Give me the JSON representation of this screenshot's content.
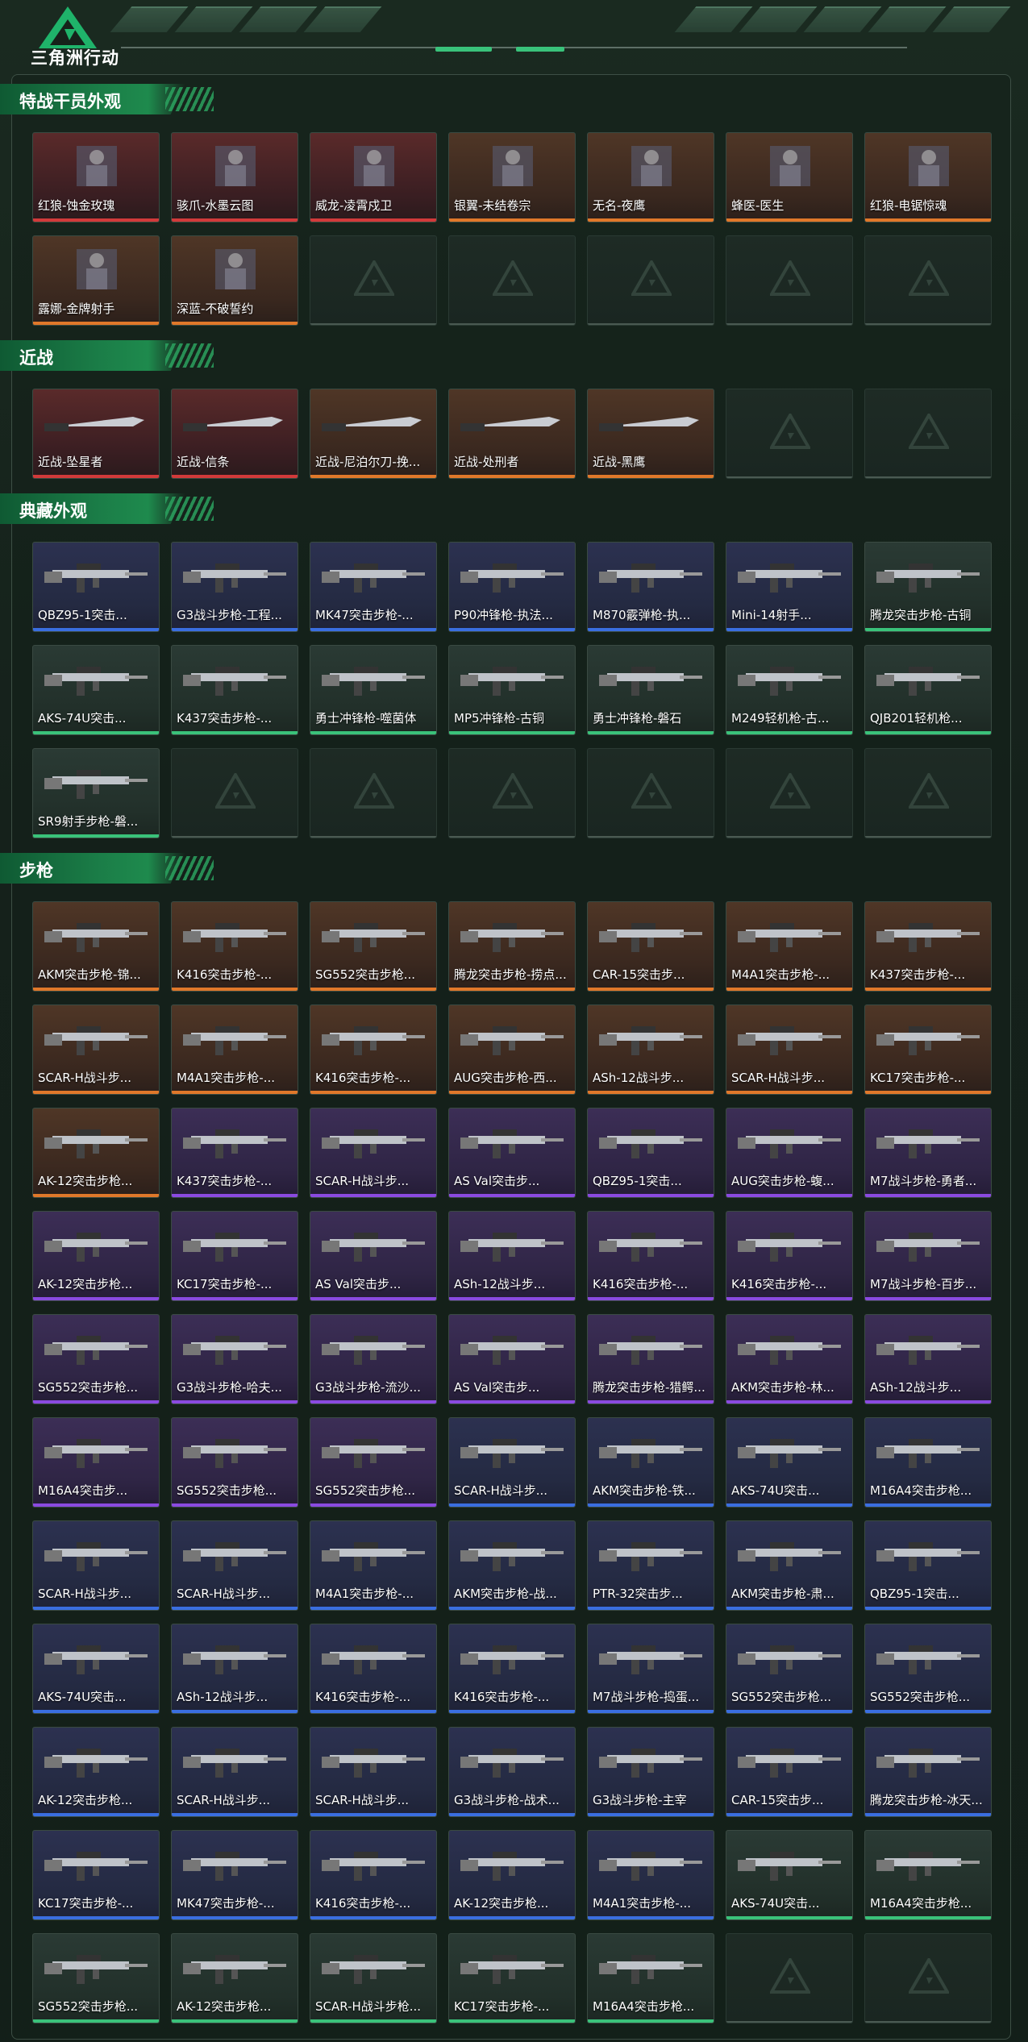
{
  "app": {
    "brand": "三角洲行动"
  },
  "colors": {
    "accent": "#39c27a",
    "panel_border": "#3d4f45",
    "red": "#d23a3a",
    "orange": "#e0782a",
    "blue": "#3a6ee0",
    "purple": "#8a4ae0",
    "green": "#3ac27a"
  },
  "sections": [
    {
      "title": "特战干员外观",
      "items": [
        {
          "label": "红狼-蚀金玫瑰",
          "rarity": "red",
          "icon": "operator-icon"
        },
        {
          "label": "骇爪-水墨云图",
          "rarity": "red",
          "icon": "operator-icon"
        },
        {
          "label": "威龙-凌霄戍卫",
          "rarity": "red",
          "icon": "operator-icon"
        },
        {
          "label": "银翼-未结卷宗",
          "rarity": "orange",
          "icon": "operator-icon"
        },
        {
          "label": "无名-夜鹰",
          "rarity": "orange",
          "icon": "operator-icon"
        },
        {
          "label": "蜂医-医生",
          "rarity": "orange",
          "icon": "operator-icon"
        },
        {
          "label": "红狼-电锯惊魂",
          "rarity": "orange",
          "icon": "operator-icon"
        },
        {
          "label": "露娜-金牌射手",
          "rarity": "orange",
          "icon": "operator-icon"
        },
        {
          "label": "深蓝-不破誓约",
          "rarity": "orange",
          "icon": "operator-icon"
        }
      ],
      "slots": 14
    },
    {
      "title": "近战",
      "items": [
        {
          "label": "近战-坠星者",
          "rarity": "red",
          "icon": "knife-icon"
        },
        {
          "label": "近战-信条",
          "rarity": "red",
          "icon": "knife-icon"
        },
        {
          "label": "近战-尼泊尔刀-挽...",
          "rarity": "orange",
          "icon": "knife-icon"
        },
        {
          "label": "近战-处刑者",
          "rarity": "orange",
          "icon": "knife-icon"
        },
        {
          "label": "近战-黑鹰",
          "rarity": "orange",
          "icon": "knife-icon"
        }
      ],
      "slots": 7
    },
    {
      "title": "典藏外观",
      "items": [
        {
          "label": "QBZ95-1突击...",
          "rarity": "blue",
          "icon": "rifle-icon"
        },
        {
          "label": "G3战斗步枪-工程...",
          "rarity": "blue",
          "icon": "rifle-icon"
        },
        {
          "label": "MK47突击步枪-...",
          "rarity": "blue",
          "icon": "rifle-icon"
        },
        {
          "label": "P90冲锋枪-执法...",
          "rarity": "blue",
          "icon": "smg-icon"
        },
        {
          "label": "M870霰弹枪-执...",
          "rarity": "blue",
          "icon": "shotgun-icon"
        },
        {
          "label": "Mini-14射手...",
          "rarity": "blue",
          "icon": "rifle-icon"
        },
        {
          "label": "腾龙突击步枪-古铜",
          "rarity": "green",
          "icon": "rifle-icon"
        },
        {
          "label": "AKS-74U突击...",
          "rarity": "green",
          "icon": "rifle-icon"
        },
        {
          "label": "K437突击步枪-...",
          "rarity": "green",
          "icon": "rifle-icon"
        },
        {
          "label": "勇士冲锋枪-噬菌体",
          "rarity": "green",
          "icon": "smg-icon"
        },
        {
          "label": "MP5冲锋枪-古铜",
          "rarity": "green",
          "icon": "smg-icon"
        },
        {
          "label": "勇士冲锋枪-磐石",
          "rarity": "green",
          "icon": "smg-icon"
        },
        {
          "label": "M249轻机枪-古...",
          "rarity": "green",
          "icon": "lmg-icon"
        },
        {
          "label": "QJB201轻机枪...",
          "rarity": "green",
          "icon": "lmg-icon"
        },
        {
          "label": "SR9射手步枪-磐...",
          "rarity": "green",
          "icon": "rifle-icon"
        }
      ],
      "slots": 21
    },
    {
      "title": "步枪",
      "items": [
        {
          "label": "AKM突击步枪-锦...",
          "rarity": "orange"
        },
        {
          "label": "K416突击步枪-...",
          "rarity": "orange"
        },
        {
          "label": "SG552突击步枪...",
          "rarity": "orange"
        },
        {
          "label": "腾龙突击步枪-捞点...",
          "rarity": "orange"
        },
        {
          "label": "CAR-15突击步...",
          "rarity": "orange"
        },
        {
          "label": "M4A1突击步枪-...",
          "rarity": "orange"
        },
        {
          "label": "K437突击步枪-...",
          "rarity": "orange"
        },
        {
          "label": "SCAR-H战斗步...",
          "rarity": "orange"
        },
        {
          "label": "M4A1突击步枪-...",
          "rarity": "orange"
        },
        {
          "label": "K416突击步枪-...",
          "rarity": "orange"
        },
        {
          "label": "AUG突击步枪-西...",
          "rarity": "orange"
        },
        {
          "label": "ASh-12战斗步...",
          "rarity": "orange"
        },
        {
          "label": "SCAR-H战斗步...",
          "rarity": "orange"
        },
        {
          "label": "KC17突击步枪-...",
          "rarity": "orange"
        },
        {
          "label": "AK-12突击步枪...",
          "rarity": "orange"
        },
        {
          "label": "K437突击步枪-...",
          "rarity": "purple"
        },
        {
          "label": "SCAR-H战斗步...",
          "rarity": "purple"
        },
        {
          "label": "AS Val突击步...",
          "rarity": "purple"
        },
        {
          "label": "QBZ95-1突击...",
          "rarity": "purple"
        },
        {
          "label": "AUG突击步枪-蝮...",
          "rarity": "purple"
        },
        {
          "label": "M7战斗步枪-勇者...",
          "rarity": "purple"
        },
        {
          "label": "AK-12突击步枪...",
          "rarity": "purple"
        },
        {
          "label": "KC17突击步枪-...",
          "rarity": "purple"
        },
        {
          "label": "AS Val突击步...",
          "rarity": "purple"
        },
        {
          "label": "ASh-12战斗步...",
          "rarity": "purple"
        },
        {
          "label": "K416突击步枪-...",
          "rarity": "purple"
        },
        {
          "label": "K416突击步枪-...",
          "rarity": "purple"
        },
        {
          "label": "M7战斗步枪-百步...",
          "rarity": "purple"
        },
        {
          "label": "SG552突击步枪...",
          "rarity": "purple"
        },
        {
          "label": "G3战斗步枪-哈夫...",
          "rarity": "purple"
        },
        {
          "label": "G3战斗步枪-流沙...",
          "rarity": "purple"
        },
        {
          "label": "AS Val突击步...",
          "rarity": "purple"
        },
        {
          "label": "腾龙突击步枪-猎鳄...",
          "rarity": "purple"
        },
        {
          "label": "AKM突击步枪-林...",
          "rarity": "purple"
        },
        {
          "label": "ASh-12战斗步...",
          "rarity": "purple"
        },
        {
          "label": "M16A4突击步...",
          "rarity": "purple"
        },
        {
          "label": "SG552突击步枪...",
          "rarity": "purple"
        },
        {
          "label": "SG552突击步枪...",
          "rarity": "purple"
        },
        {
          "label": "SCAR-H战斗步...",
          "rarity": "blue"
        },
        {
          "label": "AKM突击步枪-铁...",
          "rarity": "blue"
        },
        {
          "label": "AKS-74U突击...",
          "rarity": "blue"
        },
        {
          "label": "M16A4突击步枪...",
          "rarity": "blue"
        },
        {
          "label": "SCAR-H战斗步...",
          "rarity": "blue"
        },
        {
          "label": "SCAR-H战斗步...",
          "rarity": "blue"
        },
        {
          "label": "M4A1突击步枪-...",
          "rarity": "blue"
        },
        {
          "label": "AKM突击步枪-战...",
          "rarity": "blue"
        },
        {
          "label": "PTR-32突击步...",
          "rarity": "blue"
        },
        {
          "label": "AKM突击步枪-肃...",
          "rarity": "blue"
        },
        {
          "label": "QBZ95-1突击...",
          "rarity": "blue"
        },
        {
          "label": "AKS-74U突击...",
          "rarity": "blue"
        },
        {
          "label": "ASh-12战斗步...",
          "rarity": "blue"
        },
        {
          "label": "K416突击步枪-...",
          "rarity": "blue"
        },
        {
          "label": "K416突击步枪-...",
          "rarity": "blue"
        },
        {
          "label": "M7战斗步枪-捣蛋...",
          "rarity": "blue"
        },
        {
          "label": "SG552突击步枪...",
          "rarity": "blue"
        },
        {
          "label": "SG552突击步枪...",
          "rarity": "blue"
        },
        {
          "label": "AK-12突击步枪...",
          "rarity": "blue"
        },
        {
          "label": "SCAR-H战斗步...",
          "rarity": "blue"
        },
        {
          "label": "SCAR-H战斗步...",
          "rarity": "blue"
        },
        {
          "label": "G3战斗步枪-战术...",
          "rarity": "blue"
        },
        {
          "label": "G3战斗步枪-主宰",
          "rarity": "blue"
        },
        {
          "label": "CAR-15突击步...",
          "rarity": "blue"
        },
        {
          "label": "腾龙突击步枪-冰天...",
          "rarity": "blue"
        },
        {
          "label": "KC17突击步枪-...",
          "rarity": "blue"
        },
        {
          "label": "MK47突击步枪-...",
          "rarity": "blue"
        },
        {
          "label": "K416突击步枪-...",
          "rarity": "blue"
        },
        {
          "label": "AK-12突击步枪...",
          "rarity": "blue"
        },
        {
          "label": "M4A1突击步枪-...",
          "rarity": "blue"
        },
        {
          "label": "AKS-74U突击...",
          "rarity": "green"
        },
        {
          "label": "M16A4突击步枪...",
          "rarity": "green"
        },
        {
          "label": "SG552突击步枪...",
          "rarity": "green"
        },
        {
          "label": "AK-12突击步枪...",
          "rarity": "green"
        },
        {
          "label": "SCAR-H战斗步枪...",
          "rarity": "green"
        },
        {
          "label": "KC17突击步枪-...",
          "rarity": "green"
        },
        {
          "label": "M16A4突击步枪...",
          "rarity": "green"
        }
      ],
      "slots": 77
    }
  ]
}
